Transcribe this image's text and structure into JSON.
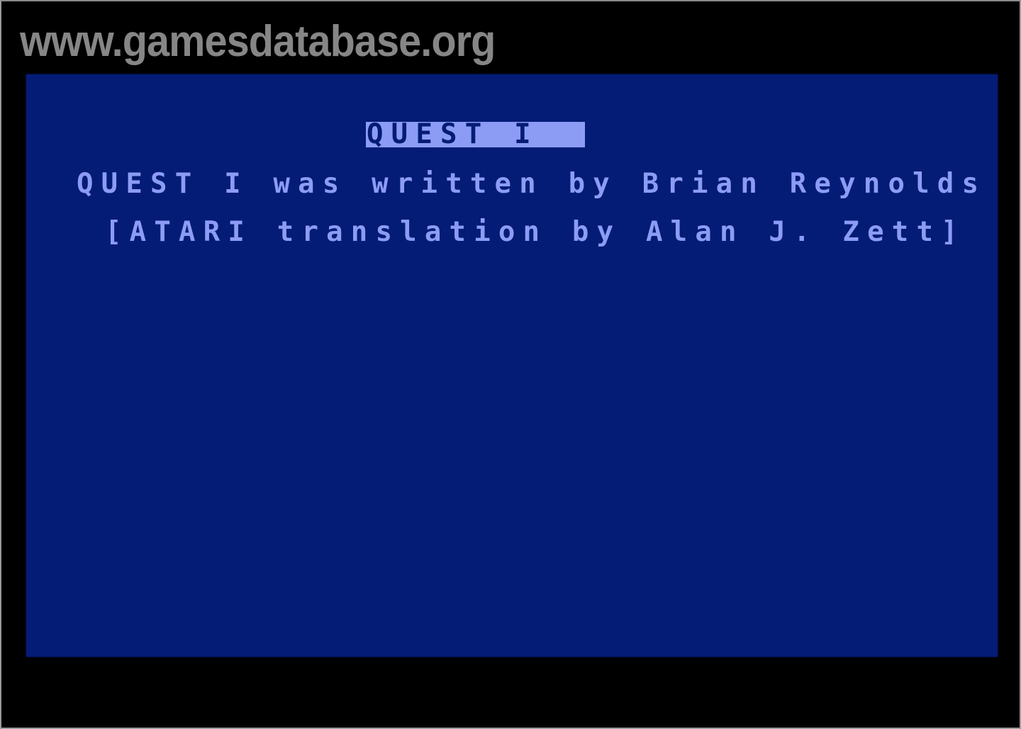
{
  "watermark": {
    "text": "www.gamesdatabase.org"
  },
  "screen": {
    "title": "QUEST I",
    "lines": [
      "QUEST I was written by Brian Reynolds",
      "[ATARI translation by Alan J. Zett]"
    ]
  },
  "colors": {
    "frame": "#000000",
    "screen_background": "#041c76",
    "text": "#8c9cf4",
    "title_bar": "#8c9cf4",
    "title_text": "#041c76",
    "watermark": "#868686"
  }
}
